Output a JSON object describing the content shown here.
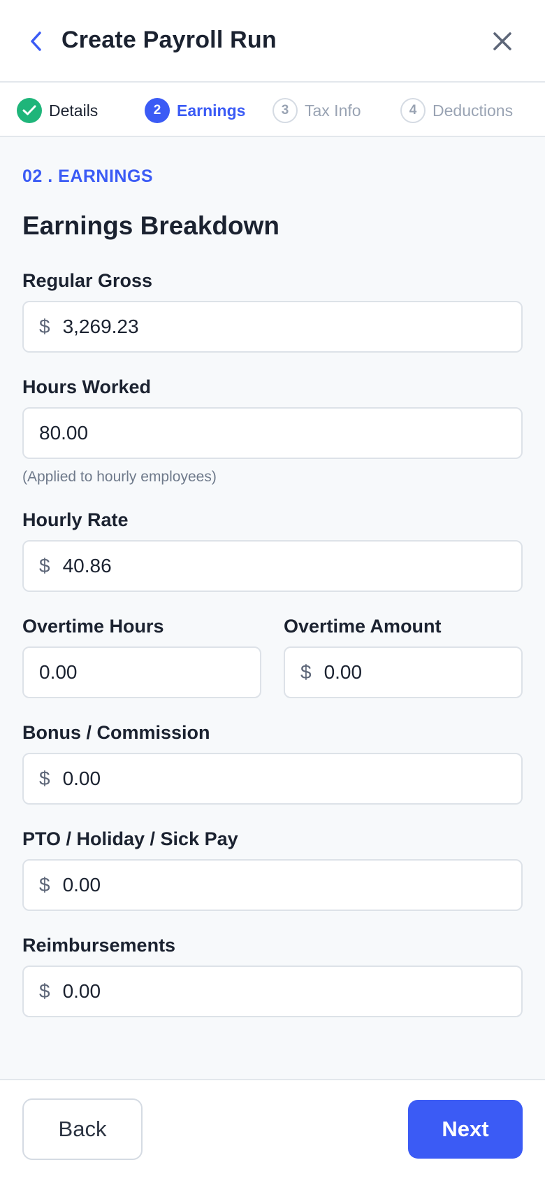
{
  "header": {
    "title": "Create Payroll Run"
  },
  "stepper": {
    "steps": [
      {
        "number": "",
        "label": "Details",
        "state": "done"
      },
      {
        "number": "2",
        "label": "Earnings",
        "state": "active"
      },
      {
        "number": "3",
        "label": "Tax Info",
        "state": "pending"
      },
      {
        "number": "4",
        "label": "Deductions",
        "state": "pending"
      }
    ]
  },
  "section": {
    "tag": "02 . EARNINGS",
    "title": "Earnings Breakdown"
  },
  "fields": {
    "regular_gross": {
      "label": "Regular Gross",
      "currency": "$",
      "value": "3,269.23"
    },
    "hours_worked": {
      "label": "Hours Worked",
      "value": "80.00",
      "helper": "(Applied to hourly employees)"
    },
    "hourly_rate": {
      "label": "Hourly Rate",
      "currency": "$",
      "value": "40.86"
    },
    "overtime_hours": {
      "label": "Overtime Hours",
      "value": "0.00"
    },
    "overtime_amount": {
      "label": "Overtime Amount",
      "currency": "$",
      "value": "0.00"
    },
    "bonus": {
      "label": "Bonus / Commission",
      "currency": "$",
      "value": "0.00"
    },
    "pto": {
      "label": "PTO / Holiday / Sick Pay",
      "currency": "$",
      "value": "0.00"
    },
    "reimbursements": {
      "label": "Reimbursements",
      "currency": "$",
      "value": "0.00"
    }
  },
  "footer": {
    "back_label": "Back",
    "next_label": "Next"
  },
  "colors": {
    "accent": "#3b5bf5",
    "success": "#1fb57a",
    "muted": "#99a3b3"
  },
  "icons": {
    "back": "chevron-left-icon",
    "close": "close-icon",
    "done": "check-icon"
  }
}
